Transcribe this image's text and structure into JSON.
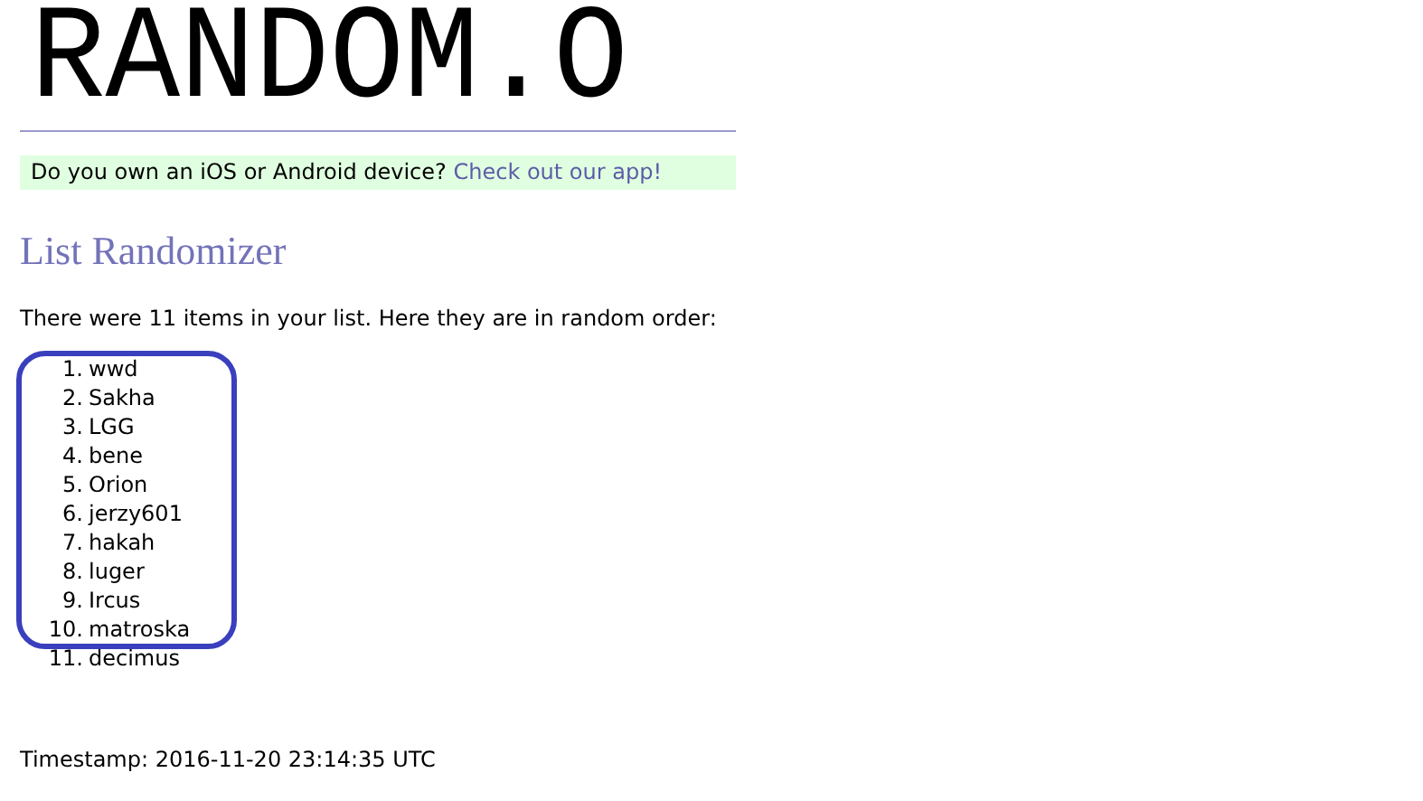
{
  "logo": "RANDOM.O",
  "promo": {
    "text": "Do you own an iOS or Android device?",
    "link": "Check out our app!"
  },
  "heading": "List Randomizer",
  "intro": "There were 11 items in your list. Here they are in random order:",
  "items": [
    {
      "number": "1.",
      "text": "wwd"
    },
    {
      "number": "2.",
      "text": "Sakha"
    },
    {
      "number": "3.",
      "text": "LGG"
    },
    {
      "number": "4.",
      "text": "bene"
    },
    {
      "number": "5.",
      "text": "Orion"
    },
    {
      "number": "6.",
      "text": "jerzy601"
    },
    {
      "number": "7.",
      "text": "hakah"
    },
    {
      "number": "8.",
      "text": "luger"
    },
    {
      "number": "9.",
      "text": "Ircus"
    },
    {
      "number": "10.",
      "text": "matroska"
    },
    {
      "number": "11.",
      "text": "decimus"
    }
  ],
  "timestamp": "Timestamp: 2016-11-20 23:14:35 UTC"
}
